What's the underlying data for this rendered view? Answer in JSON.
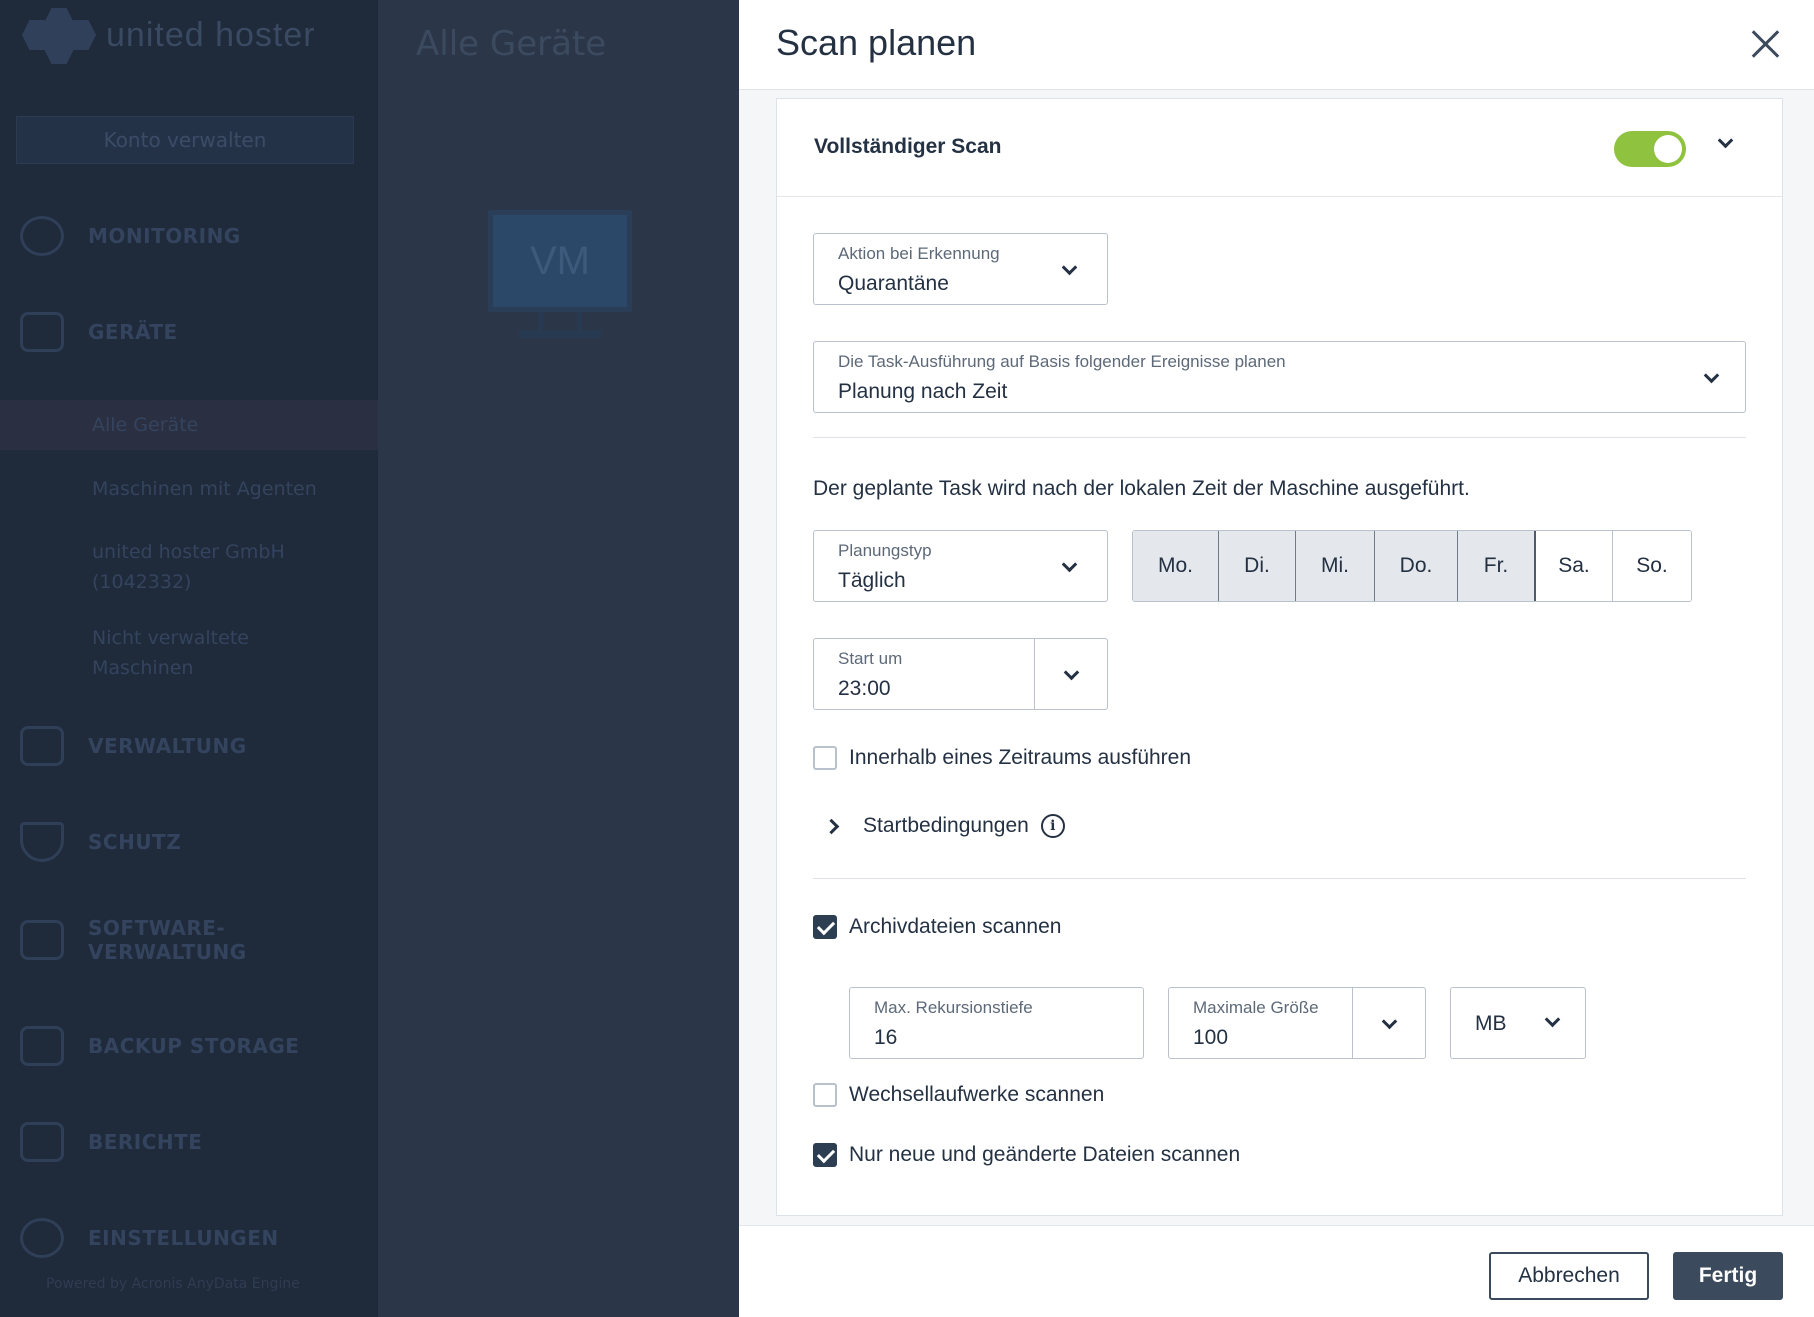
{
  "background": {
    "logo_text": "united hoster",
    "account_button": "Konto verwalten",
    "page_title": "Alle Geräte",
    "vm_label": "VM",
    "nav": [
      {
        "label": "MONITORING",
        "icon": "gauge-icon"
      },
      {
        "label": "GERÄTE",
        "icon": "monitor-icon"
      },
      {
        "label": "VERWALTUNG",
        "icon": "copy-icon"
      },
      {
        "label": "SCHUTZ",
        "icon": "shield-icon"
      },
      {
        "label": "SOFTWARE-",
        "icon": "download-icon"
      },
      {
        "label": "VERWALTUNG",
        "icon": ""
      },
      {
        "label": "BACKUP STORAGE",
        "icon": "drive-icon"
      },
      {
        "label": "BERICHTE",
        "icon": "clipboard-icon"
      },
      {
        "label": "EINSTELLUNGEN",
        "icon": "gear-icon"
      }
    ],
    "sub_nav": [
      "Alle Geräte",
      "Maschinen mit Agenten",
      "united hoster GmbH",
      "(1042332)",
      "Nicht verwaltete",
      "Maschinen"
    ],
    "footer": "Powered by Acronis AnyData Engine"
  },
  "dialog": {
    "title": "Scan planen",
    "section_title": "Vollständiger Scan",
    "toggle_on": true,
    "action": {
      "label": "Aktion bei Erkennung",
      "value": "Quarantäne"
    },
    "schedule_event": {
      "label": "Die Task-Ausführung auf Basis folgender Ereignisse planen",
      "value": "Planung nach Zeit"
    },
    "info_text": "Der geplante Task wird nach der lokalen Zeit der Maschine ausgeführt.",
    "planning_type": {
      "label": "Planungstyp",
      "value": "Täglich"
    },
    "days": [
      {
        "label": "Mo.",
        "selected": true
      },
      {
        "label": "Di.",
        "selected": true
      },
      {
        "label": "Mi.",
        "selected": true
      },
      {
        "label": "Do.",
        "selected": true
      },
      {
        "label": "Fr.",
        "selected": true
      },
      {
        "label": "Sa.",
        "selected": false
      },
      {
        "label": "So.",
        "selected": false
      }
    ],
    "start_at": {
      "label": "Start um",
      "value": "23:00"
    },
    "within_range": {
      "label": "Innerhalb eines Zeitraums ausführen",
      "checked": false
    },
    "start_conditions": "Startbedingungen",
    "scan_archives": {
      "label": "Archivdateien scannen",
      "checked": true
    },
    "max_recursion": {
      "label": "Max. Rekursionstiefe",
      "value": "16"
    },
    "max_size": {
      "label": "Maximale Größe",
      "value": "100"
    },
    "size_unit": "MB",
    "removable_drives": {
      "label": "Wechsellaufwerke scannen",
      "checked": false
    },
    "only_new_changed": {
      "label": "Nur neue und geänderte Dateien scannen",
      "checked": true
    },
    "cancel_button": "Abbrechen",
    "done_button": "Fertig"
  },
  "colors": {
    "toggle_on": "#8ec23f",
    "primary_button": "#3b4a5c",
    "overlay": "#2b3649"
  }
}
